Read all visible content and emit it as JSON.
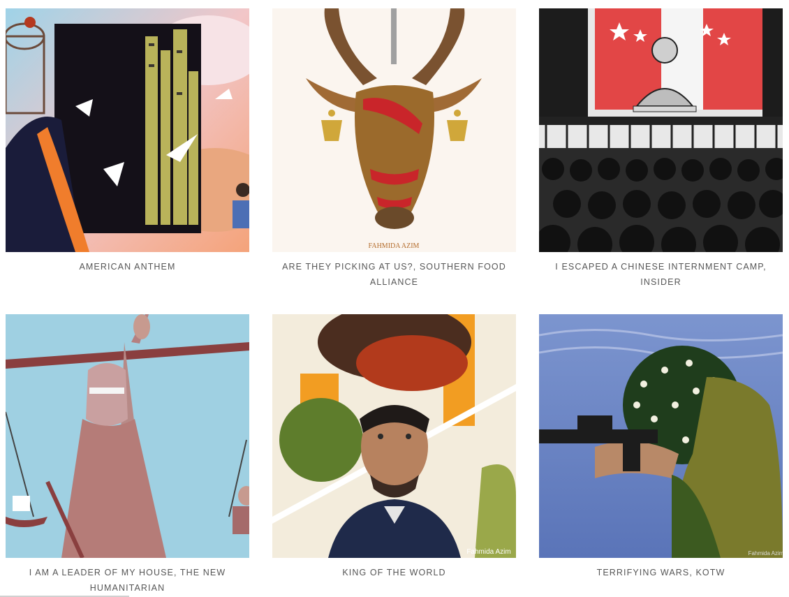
{
  "gallery": {
    "items": [
      {
        "title": "AMERICAN ANTHEM",
        "artwork": "american-anthem-illustration"
      },
      {
        "title": "ARE THEY PICKING AT US?, SOUTHERN FOOD ALLIANCE",
        "artwork": "goat-head-illustration",
        "signature": "FAHMIDA AZIM"
      },
      {
        "title": "I ESCAPED A CHINESE INTERNMENT CAMP, INSIDER",
        "artwork": "internment-camp-illustration"
      },
      {
        "title": "I AM A LEADER OF MY HOUSE, THE NEW HUMANITARIAN",
        "artwork": "blindfolded-woman-scale-illustration"
      },
      {
        "title": "KING OF THE WORLD",
        "artwork": "split-portrait-illustration",
        "signature": "Fahmida Azim"
      },
      {
        "title": "TERRIFYING WARS, KOTW",
        "artwork": "flower-soldier-illustration",
        "signature": "Fahmida Azim"
      }
    ]
  },
  "colors": {
    "caption": "#555555",
    "background": "#ffffff"
  }
}
